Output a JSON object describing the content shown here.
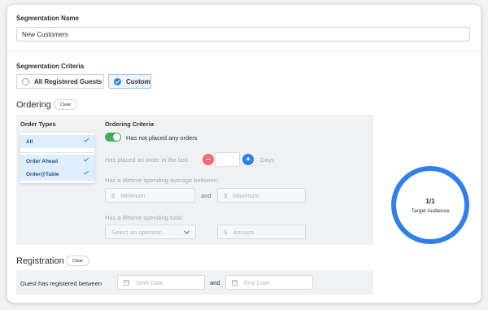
{
  "segmentation_name": {
    "label": "Segmentation Name",
    "value": "New Customers"
  },
  "criteria": {
    "label": "Segmentation Criteria",
    "options": [
      {
        "label": "All Registered Guests",
        "selected": false
      },
      {
        "label": "Custom",
        "selected": true
      }
    ]
  },
  "ordering": {
    "title": "Ordering",
    "clear_label": "Clear",
    "order_types": {
      "label": "Order Types",
      "items": [
        {
          "label": "All",
          "checked": true
        },
        {
          "label": "Order Ahead",
          "checked": true
        },
        {
          "label": "Order@Table",
          "checked": true
        }
      ]
    },
    "criteria": {
      "label": "Ordering Criteria",
      "toggle_label": "Has not placed any orders",
      "toggle_on": true,
      "placed_in_last_label": "Has placed an order in the last",
      "minus": "−",
      "plus": "+",
      "days_label": "Days",
      "lifetime_avg_label": "Has a lifetime spending average between:",
      "currency_symbol": "$",
      "minimum_placeholder": "Minimum",
      "and_label": "and",
      "maximum_placeholder": "Maximum",
      "lifetime_total_label": "Has a lifetime spending total:",
      "operator_placeholder": "Select an operator...",
      "amount_placeholder": "Amount"
    }
  },
  "registration": {
    "title": "Registration",
    "clear_label": "Clear",
    "registered_between_label": "Guest has registered between",
    "start_placeholder": "Start Date",
    "and_label": "and",
    "end_placeholder": "End Date"
  },
  "audience": {
    "count": "1/1",
    "label": "Target Audience"
  },
  "colors": {
    "accent": "#2f80ed",
    "toggle_on": "#3fae5a",
    "minus": "#f06b73"
  }
}
